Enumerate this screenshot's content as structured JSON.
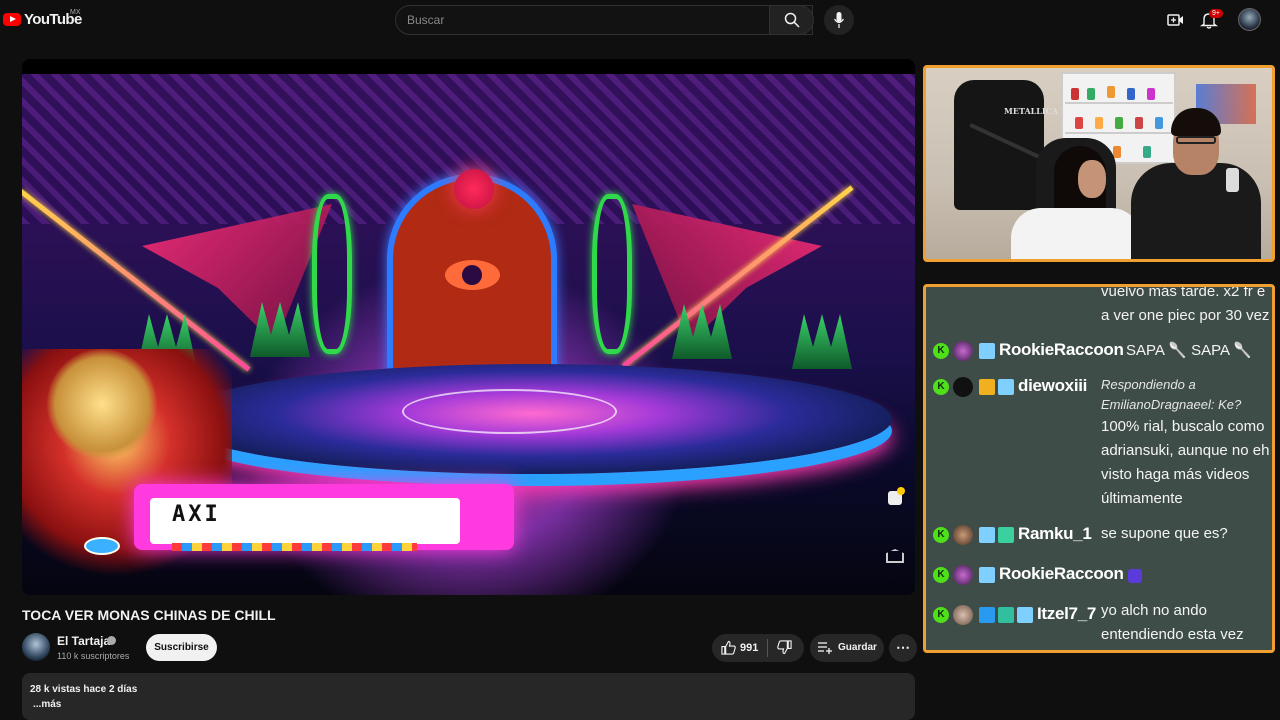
{
  "header": {
    "logo_text": "YouTube",
    "region": "MX",
    "search_placeholder": "Buscar",
    "notifications_badge": "9+",
    "icons": [
      "youtube-logo",
      "search-icon",
      "mic-icon",
      "create-icon",
      "bell-icon",
      "avatar"
    ]
  },
  "player": {
    "lower_third_text": "AXI"
  },
  "video": {
    "title": "TOCA VER MONAS CHINAS DE CHILL",
    "channel_name": "El Tartaja",
    "subscribers": "110 k suscriptores",
    "subscribe_label": "Suscribirse",
    "likes": "991",
    "save_label": "Guardar",
    "more_label": "⋯",
    "views_date": "28 k vistas  hace 2 días",
    "description_more": "...más"
  },
  "webcam": {
    "jacket_text": "METALLICA"
  },
  "chat": {
    "top_message": "vuelvo más tarde. x2 fr e a ver one piec por 30 vez",
    "messages": [
      {
        "user": "RookieRaccoon",
        "message": "SAPA 🥄 SAPA 🥄"
      },
      {
        "user": "diewoxiii",
        "reply_to": "Respondiendo a EmilianoDragnaeel: Ke?",
        "message": "100% rial, buscalo como adriansuki, aunque no eh visto haga más videos últimamente"
      },
      {
        "user": "Ramku_1",
        "message": "se supone que es?"
      },
      {
        "user": "RookieRaccoon",
        "message": ""
      },
      {
        "user": "Itzel7_7",
        "message": "yo alch no ando entendiendo esta vez"
      }
    ],
    "colors": {
      "border": "#f0a030",
      "background": "#3f4d48",
      "kick": "#4ee01a"
    }
  }
}
